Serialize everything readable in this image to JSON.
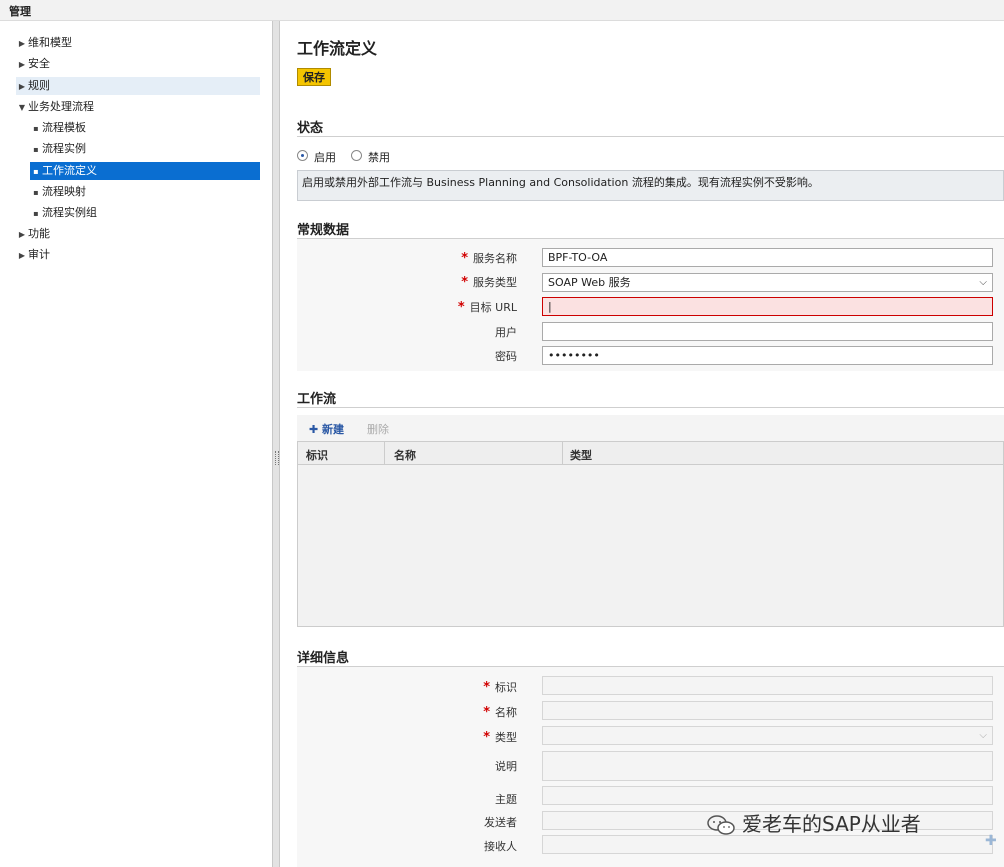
{
  "app": {
    "title": "管理"
  },
  "sidebar": {
    "items": [
      {
        "label": "维和模型"
      },
      {
        "label": "安全"
      },
      {
        "label": "规则"
      },
      {
        "label": "业务处理流程"
      },
      {
        "label": "流程模板"
      },
      {
        "label": "流程实例"
      },
      {
        "label": "工作流定义"
      },
      {
        "label": "流程映射"
      },
      {
        "label": "流程实例组"
      },
      {
        "label": "功能"
      },
      {
        "label": "审计"
      }
    ]
  },
  "main": {
    "title": "工作流定义",
    "save_label": "保存",
    "status": {
      "title": "状态",
      "enable_label": "启用",
      "disable_label": "禁用",
      "info": "启用或禁用外部工作流与 Business Planning and Consolidation 流程的集成。现有流程实例不受影响。"
    },
    "general": {
      "title": "常规数据",
      "service_name_label": "服务名称",
      "service_name_value": "BPF-TO-OA",
      "service_type_label": "服务类型",
      "service_type_value": "SOAP Web 服务",
      "target_url_label": "目标 URL",
      "target_url_value": "|",
      "user_label": "用户",
      "user_value": "",
      "password_label": "密码",
      "password_value": "••••••••"
    },
    "workflow": {
      "title": "工作流",
      "new_label": "新建",
      "delete_label": "删除",
      "columns": [
        "标识",
        "名称",
        "类型"
      ]
    },
    "details": {
      "title": "详细信息",
      "id_label": "标识",
      "name_label": "名称",
      "type_label": "类型",
      "desc_label": "说明",
      "subject_label": "主题",
      "sender_label": "发送者",
      "recipient_label": "接收人"
    }
  },
  "watermark": {
    "text": "爱老车的SAP从业者"
  },
  "colors": {
    "accent": "#0a6ed1",
    "save": "#f4c400",
    "required": "#d10000",
    "error_bg": "#fbe1e1"
  }
}
